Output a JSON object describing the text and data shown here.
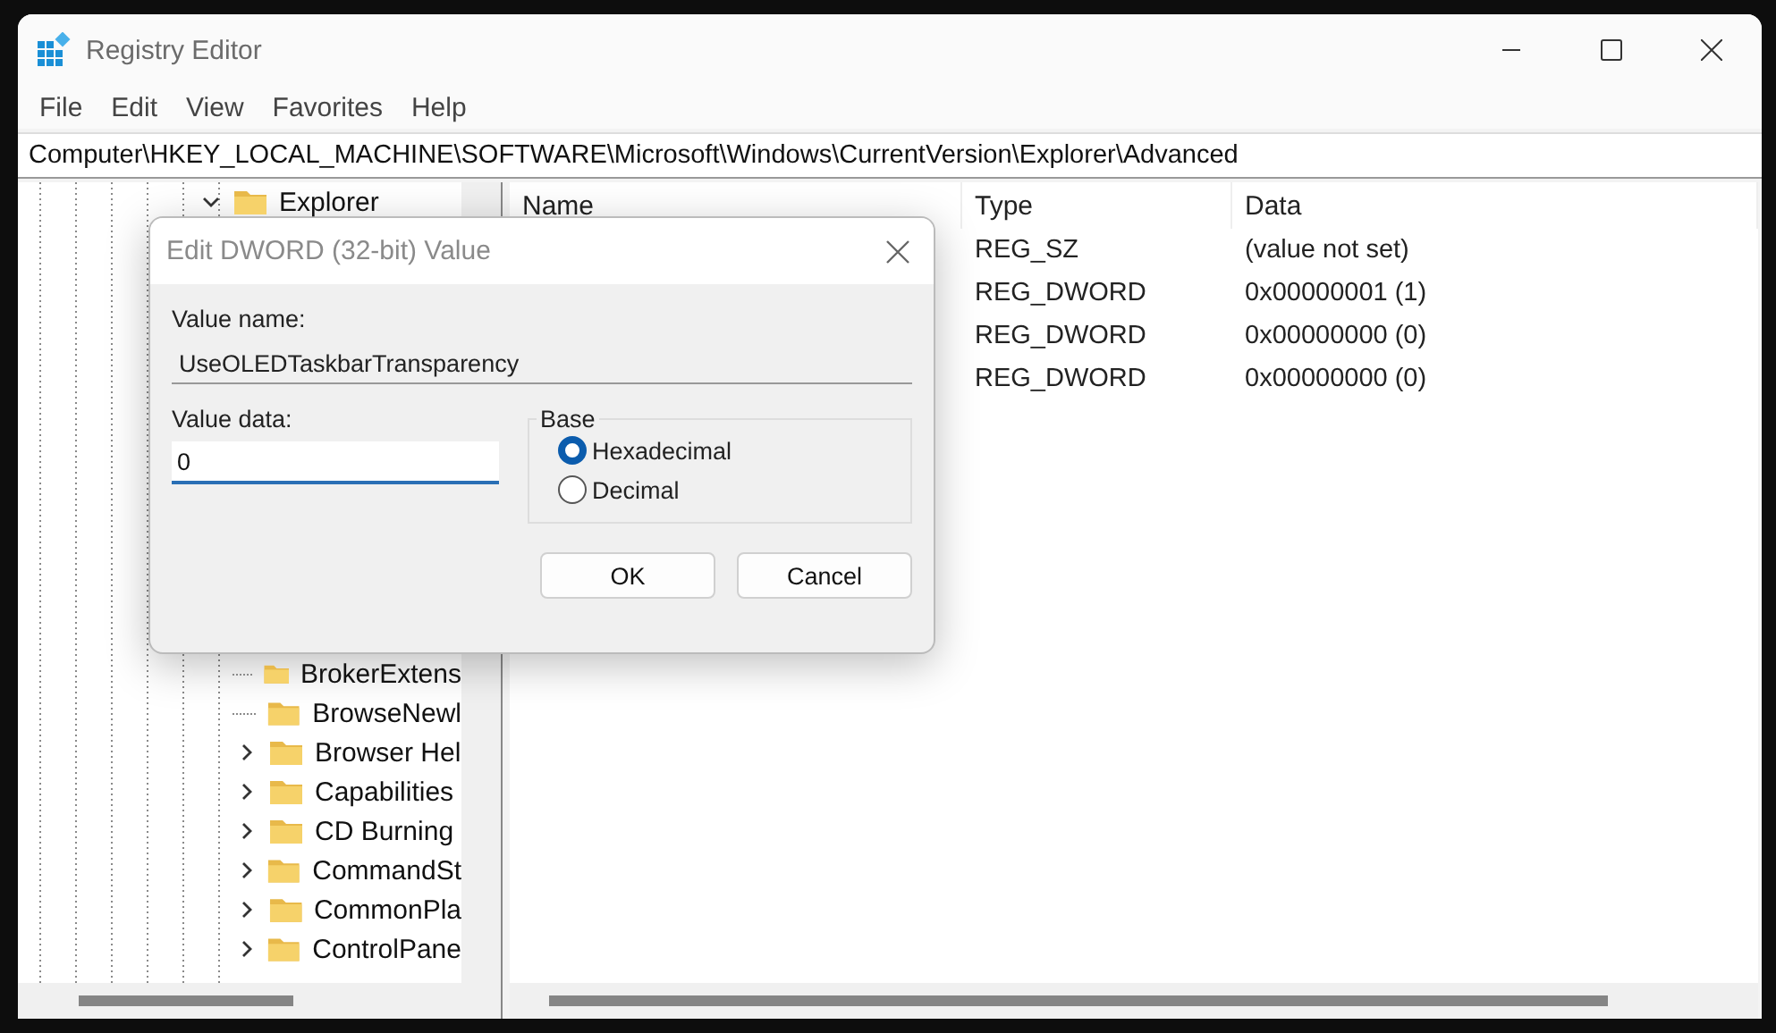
{
  "window": {
    "title": "Registry Editor"
  },
  "menu": [
    "File",
    "Edit",
    "View",
    "Favorites",
    "Help"
  ],
  "address": "Computer\\HKEY_LOCAL_MACHINE\\SOFTWARE\\Microsoft\\Windows\\CurrentVersion\\Explorer\\Advanced",
  "tree": {
    "top": {
      "label": "Explorer",
      "expanded": true
    },
    "items": [
      {
        "label": "BrokerExtens",
        "has_children": false
      },
      {
        "label": "BrowseNewl",
        "has_children": false
      },
      {
        "label": "Browser Hel",
        "has_children": true
      },
      {
        "label": "Capabilities",
        "has_children": true
      },
      {
        "label": "CD Burning",
        "has_children": true
      },
      {
        "label": "CommandSt",
        "has_children": true
      },
      {
        "label": "CommonPla",
        "has_children": true
      },
      {
        "label": "ControlPane",
        "has_children": true
      }
    ]
  },
  "values": {
    "columns": [
      "Name",
      "Type",
      "Data"
    ],
    "rows": [
      {
        "type": "REG_SZ",
        "data": "(value not set)"
      },
      {
        "type": "REG_DWORD",
        "data": "0x00000001 (1)"
      },
      {
        "type": "REG_DWORD",
        "data": "0x00000000 (0)"
      },
      {
        "type": "REG_DWORD",
        "data": "0x00000000 (0)"
      }
    ]
  },
  "dialog": {
    "title": "Edit DWORD (32-bit) Value",
    "value_name_label": "Value name:",
    "value_name": "UseOLEDTaskbarTransparency",
    "value_data_label": "Value data:",
    "value_data": "0",
    "base": {
      "label": "Base",
      "options": [
        {
          "label": "Hexadecimal",
          "selected": true
        },
        {
          "label": "Decimal",
          "selected": false
        }
      ]
    },
    "buttons": [
      "OK",
      "Cancel"
    ]
  }
}
